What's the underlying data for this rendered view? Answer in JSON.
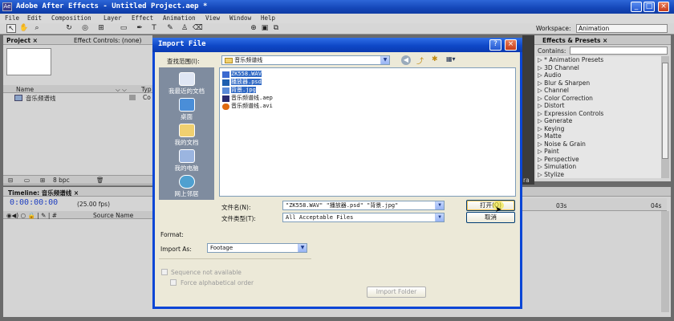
{
  "app": {
    "title": "Adobe After Effects - Untitled Project.aep *",
    "icon": "ae-app-icon"
  },
  "window_buttons": [
    "_",
    "□",
    "×"
  ],
  "menu": [
    "File",
    "Edit",
    "Composition",
    "Layer",
    "Effect",
    "Animation",
    "View",
    "Window",
    "Help"
  ],
  "toolbar": {
    "workspace_label": "Workspace:",
    "workspace_value": "Animation"
  },
  "project": {
    "tab": "Project ×",
    "effect_controls_tab": "Effect Controls: (none)",
    "col_name": "Name",
    "col_type": "Typ",
    "item_name": "音乐频谱线",
    "item_type": "Co",
    "bpc": "8 bpc"
  },
  "effects": {
    "tab": "Effects & Presets ×",
    "contains_label": "Contains:",
    "items": [
      "* Animation Presets",
      "3D Channel",
      "Audio",
      "Blur & Sharpen",
      "Channel",
      "Color Correction",
      "Distort",
      "Expression Controls",
      "Generate",
      "Keying",
      "Matte",
      "Noise & Grain",
      "Paint",
      "Perspective",
      "Simulation",
      "Stylize"
    ]
  },
  "timeline": {
    "tab": "Timeline: 音乐频谱线 ×",
    "timecode": "0:00:00:00",
    "fps": "(25.00 fps)",
    "col_source": "Source Name",
    "ruler": [
      "03s",
      "04s"
    ],
    "edge_text": "ra"
  },
  "dialog": {
    "title": "Import File",
    "look_in_label": "查找范围(I):",
    "look_in_value": "音乐频谱线",
    "places": [
      "我最近的文档",
      "桌面",
      "我的文档",
      "我的电脑",
      "网上邻居"
    ],
    "files": [
      {
        "name": "ZK558.WAV",
        "icon": "wav-file-icon",
        "selected": true
      },
      {
        "name": "播放器.psd",
        "icon": "psd-file-icon",
        "selected": true
      },
      {
        "name": "背景.jpg",
        "icon": "jpg-file-icon",
        "selected": true
      },
      {
        "name": "音乐频谱线.aep",
        "icon": "aep-file-icon",
        "selected": false
      },
      {
        "name": "音乐频谱线.avi",
        "icon": "avi-file-icon",
        "selected": false
      }
    ],
    "filename_label": "文件名(N):",
    "filename_value": "\"ZK558.WAV\" \"播放器.psd\" \"背景.jpg\"",
    "filetype_label": "文件类型(T):",
    "filetype_value": "All Acceptable Files",
    "open_button": "打开(O)",
    "cancel_button": "取消",
    "format_label": "Format:",
    "import_as_label": "Import As:",
    "import_as_value": "Footage",
    "sequence_label": "Sequence not available",
    "force_alpha_label": "Force alphabetical order",
    "import_folder_button": "Import Folder"
  }
}
